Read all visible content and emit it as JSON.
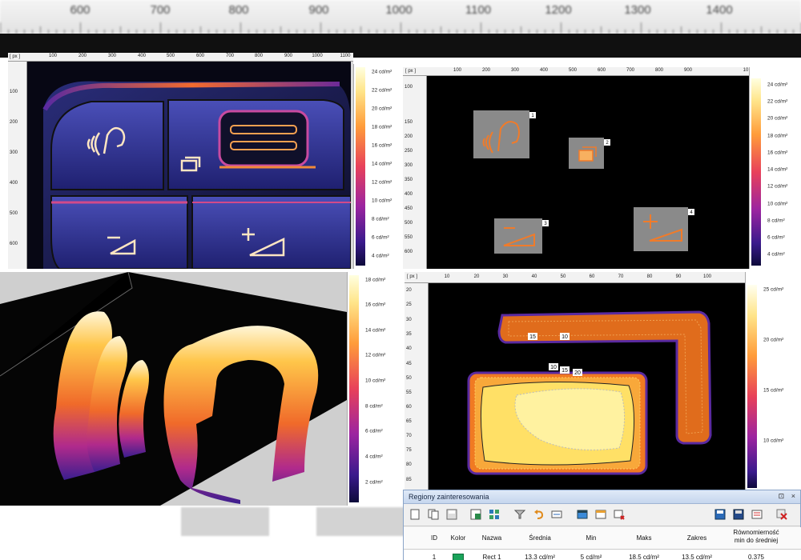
{
  "top_ruler": {
    "labels": [
      "600",
      "700",
      "800",
      "900",
      "1000",
      "1100",
      "1200",
      "1300",
      "1400"
    ]
  },
  "panel_photo": {
    "ruler_unit": "[ px ]",
    "x_ticks": [
      "100",
      "200",
      "300",
      "400",
      "500",
      "600",
      "700",
      "800",
      "900",
      "1000",
      "1100"
    ],
    "y_ticks": [
      "100",
      "200",
      "300",
      "400",
      "500",
      "600"
    ],
    "scale_labels": [
      "24 cd/m²",
      "22 cd/m²",
      "20 cd/m²",
      "18 cd/m²",
      "16 cd/m²",
      "14 cd/m²",
      "12 cd/m²",
      "10 cd/m²",
      "8 cd/m²",
      "6 cd/m²",
      "4 cd/m²"
    ]
  },
  "panel_regions": {
    "ruler_unit": "[ px ]",
    "x_ticks": [
      "100",
      "200",
      "300",
      "400",
      "500",
      "600",
      "700",
      "800",
      "900",
      "10"
    ],
    "y_ticks": [
      "100",
      "150",
      "200",
      "250",
      "300",
      "350",
      "400",
      "450",
      "500",
      "550",
      "600"
    ],
    "region_ids": [
      "1",
      "2",
      "3",
      "4"
    ],
    "scale_labels": [
      "24 cd/m²",
      "22 cd/m²",
      "20 cd/m²",
      "18 cd/m²",
      "16 cd/m²",
      "14 cd/m²",
      "12 cd/m²",
      "10 cd/m²",
      "8 cd/m²",
      "6 cd/m²",
      "4 cd/m²"
    ]
  },
  "panel_3d": {
    "scale_labels": [
      "18 cd/m²",
      "16 cd/m²",
      "14 cd/m²",
      "12 cd/m²",
      "10 cd/m²",
      "8 cd/m²",
      "6 cd/m²",
      "4 cd/m²",
      "2 cd/m²"
    ]
  },
  "panel_contour": {
    "ruler_unit": "[ px ]",
    "x_ticks": [
      "10",
      "20",
      "30",
      "40",
      "50",
      "60",
      "70",
      "80",
      "90",
      "100"
    ],
    "y_ticks": [
      "20",
      "25",
      "30",
      "35",
      "40",
      "45",
      "50",
      "55",
      "60",
      "65",
      "70",
      "75",
      "80",
      "85"
    ],
    "contour_labels": [
      "15",
      "10",
      "10",
      "15",
      "20"
    ],
    "scale_labels": [
      "25 cd/m²",
      "20 cd/m²",
      "15 cd/m²",
      "10 cd/m²"
    ]
  },
  "roi_dialog": {
    "title": "Regiony zainteresowania",
    "controls": [
      "⊡",
      "×"
    ],
    "columns": [
      "ID",
      "Kolor",
      "Nazwa",
      "Średnia",
      "Min",
      "Maks",
      "Zakres"
    ],
    "uniformity_header_line1": "Równomierność",
    "uniformity_header_line2": "min do średniej",
    "row": {
      "id": "1",
      "color": "#1aa35a",
      "name": "Rect 1",
      "mean": "13.3 cd/m²",
      "min": "5 cd/m²",
      "max": "18.5 cd/m²",
      "range": "13.5 cd/m²",
      "uniformity": "0.375"
    }
  }
}
